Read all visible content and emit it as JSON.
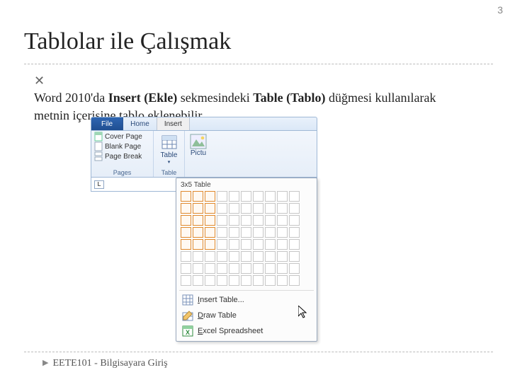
{
  "page_number": "3",
  "title": "Tablolar ile Çalışmak",
  "bullet": {
    "prefix": "Word 2010'da ",
    "bold1": "Insert (Ekle)",
    "mid": " sekmesindeki ",
    "bold2": "Table (Tablo)",
    "suffix": " düğmesi kullanılarak metnin içerisine tablo eklenebilir."
  },
  "footer": "EETE101 - Bilgisayara Giriş",
  "ribbon": {
    "tabs": {
      "file": "File",
      "home": "Home",
      "insert": "Insert"
    },
    "groups": {
      "pages": {
        "label": "Pages",
        "items": [
          "Cover Page",
          "Blank Page",
          "Page Break"
        ]
      },
      "tables": {
        "label": "Table",
        "btn": "Table"
      },
      "illustrations": {
        "pic": "Pictu"
      }
    },
    "ruler_char": "L"
  },
  "dropdown": {
    "dim": "3x5 Table",
    "cols": 10,
    "rows": 8,
    "sel_cols": 3,
    "sel_rows": 5,
    "items": [
      {
        "icon": "grid-icon",
        "label": "Insert Table..."
      },
      {
        "icon": "pencil-icon",
        "label": "Draw Table"
      },
      {
        "icon": "excel-icon",
        "label": "Excel Spreadsheet"
      }
    ]
  }
}
